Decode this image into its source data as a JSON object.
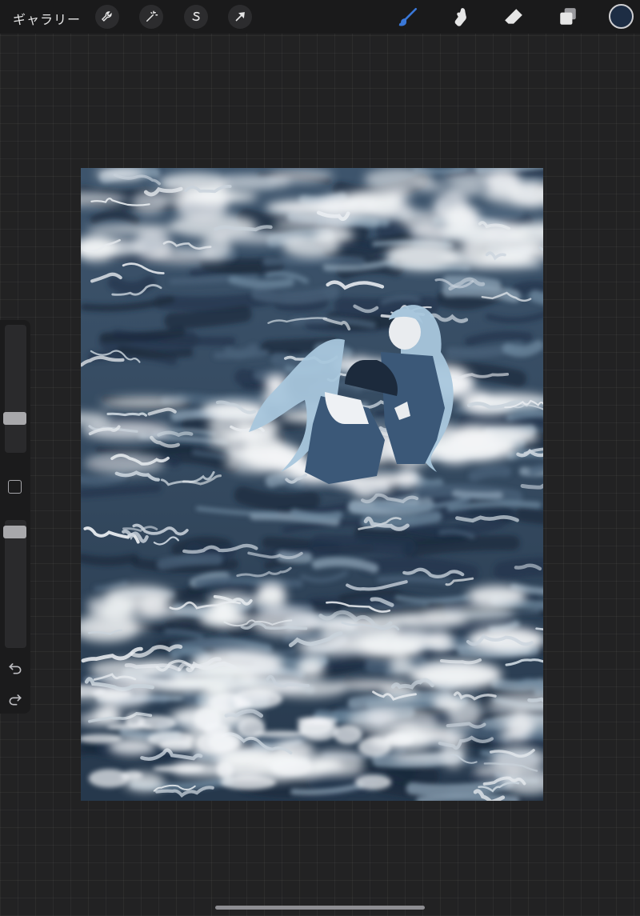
{
  "topbar": {
    "gallery_label": "ギャラリー",
    "left_tools": [
      {
        "icon": "wrench-icon",
        "name": "actions"
      },
      {
        "icon": "magic-wand-icon",
        "name": "adjustments"
      },
      {
        "icon": "selection-s-icon",
        "name": "selection"
      },
      {
        "icon": "arrow-cursor-icon",
        "name": "transform"
      }
    ],
    "right_tools": [
      {
        "icon": "brush-icon",
        "name": "paint",
        "active": true
      },
      {
        "icon": "smudge-finger-icon",
        "name": "smudge"
      },
      {
        "icon": "eraser-icon",
        "name": "erase"
      },
      {
        "icon": "layers-icon",
        "name": "layers"
      }
    ],
    "current_color": "#1d2d44",
    "active_tool_color": "#3a78d8"
  },
  "sidebar": {
    "brush_size": 0.24,
    "brush_opacity": 0.95,
    "icons": [
      "modify-square-icon",
      "undo-icon",
      "redo-icon"
    ]
  },
  "canvas": {
    "palette": {
      "deep": "#22354c",
      "mid": "#4a627a",
      "light": "#8ea3b6",
      "foam": "#f2f4f6",
      "hair": "#a8c6dc",
      "dress": "#3b5878"
    }
  }
}
